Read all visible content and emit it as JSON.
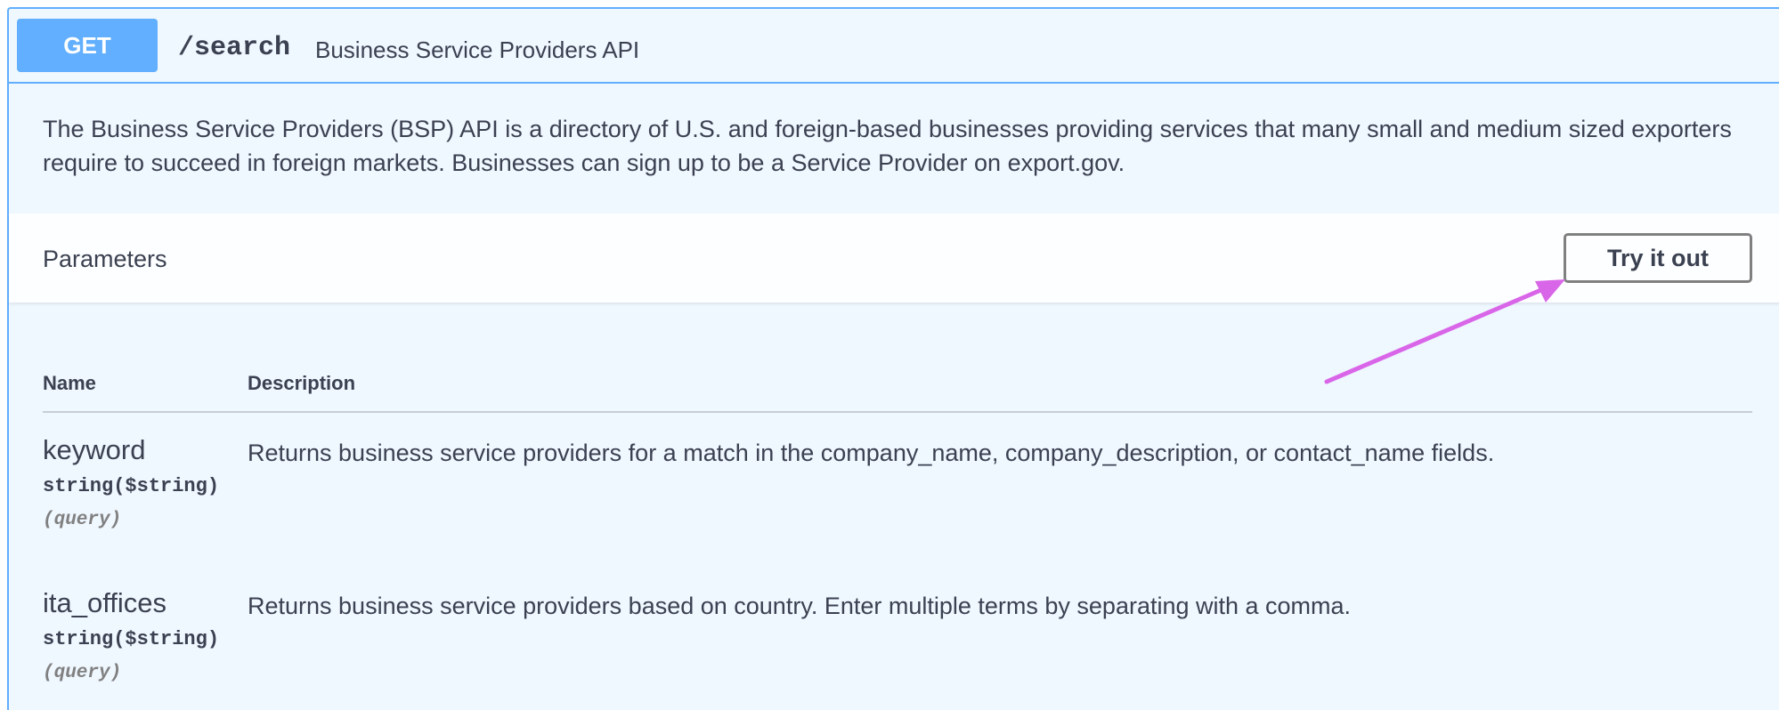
{
  "operation": {
    "method": "GET",
    "path": "/search",
    "summary": "Business Service Providers API",
    "description": "The Business Service Providers (BSP) API is a directory of U.S. and foreign-based businesses providing services that many small and medium sized exporters require to succeed in foreign markets. Businesses can sign up to be a Service Provider on export.gov."
  },
  "parameters": {
    "title": "Parameters",
    "try_label": "Try it out",
    "columns": {
      "name": "Name",
      "description": "Description"
    },
    "items": [
      {
        "name": "keyword",
        "type": "string($string)",
        "in": "(query)",
        "description": "Returns business service providers for a match in the company_name, company_description, or contact_name fields."
      },
      {
        "name": "ita_offices",
        "type": "string($string)",
        "in": "(query)",
        "description": "Returns business service providers based on country. Enter multiple terms by separating with a comma."
      }
    ]
  },
  "colors": {
    "method_get": "#61affe",
    "block_background": "#eff7ff",
    "annotation_arrow": "#d966e8"
  }
}
